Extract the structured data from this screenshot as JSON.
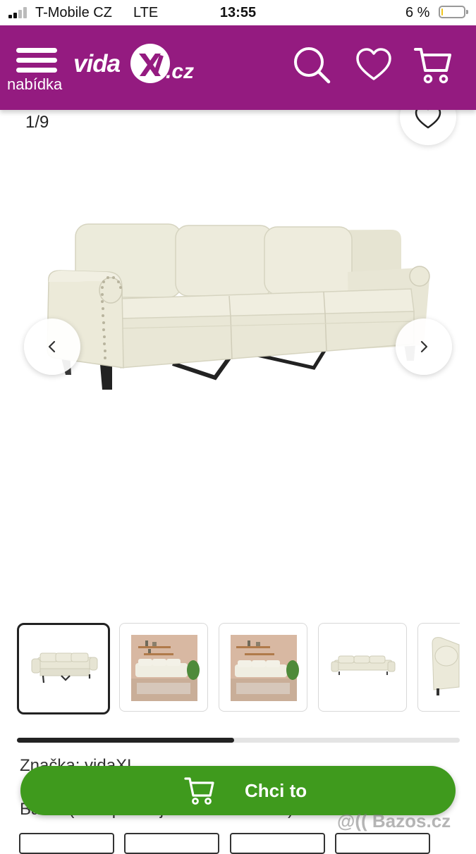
{
  "status_bar": {
    "carrier": "T-Mobile CZ",
    "network": "LTE",
    "time": "13:55",
    "battery_percent": "6 %",
    "battery_level": 0.06
  },
  "header": {
    "menu_label": "nabídka",
    "logo_text": "vida",
    "logo_tld": ".cz",
    "background_color": "#941b80",
    "icons": [
      "search-icon",
      "heart-icon",
      "cart-icon"
    ]
  },
  "gallery": {
    "counter": "1/9",
    "thumbnail_count": 5,
    "scroll_progress": 0.49
  },
  "details": {
    "brand_line": "Značka: vidaXL",
    "color_line": "Barva (K dispozici jsou 20 možností)"
  },
  "cta": {
    "label": "Chci to",
    "color": "#3f9a1d"
  },
  "watermark": "@(( Bazos.cz"
}
